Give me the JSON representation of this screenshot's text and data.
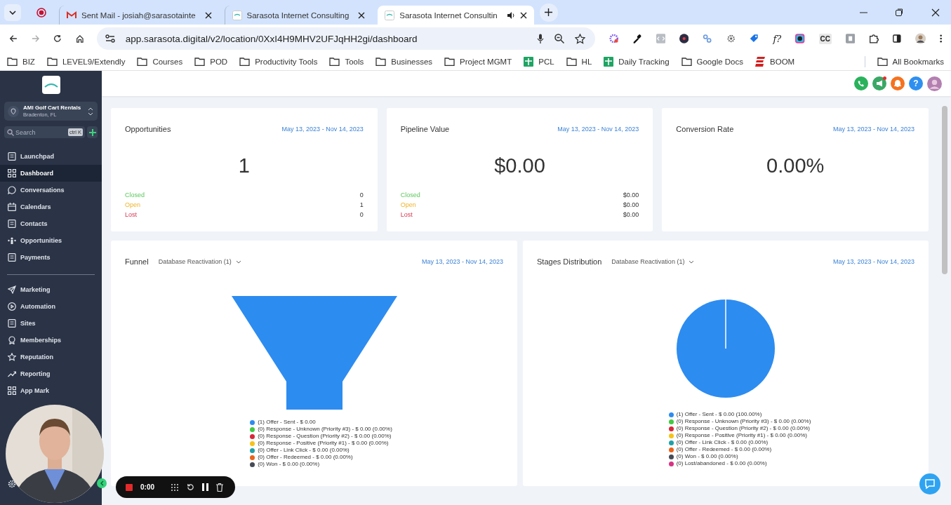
{
  "browser": {
    "tabs": [
      {
        "title": "Sent Mail - josiah@sarasotainte",
        "kind": "mail",
        "selected": false,
        "audio": false
      },
      {
        "title": "Sarasota Internet Consulting",
        "kind": "site",
        "selected": false,
        "audio": false
      },
      {
        "title": "Sarasota Internet Consultin",
        "kind": "site",
        "selected": true,
        "audio": true
      }
    ],
    "url": "app.sarasota.digital/v2/location/0XxI4H9MHV2UFJqHH2gi/dashboard",
    "extensions_text": [
      "f?",
      "CC"
    ],
    "bookmarks": [
      {
        "label": "BIZ",
        "kind": "folder"
      },
      {
        "label": "LEVEL9/Extendly",
        "kind": "folder"
      },
      {
        "label": "Courses",
        "kind": "folder"
      },
      {
        "label": "POD",
        "kind": "folder"
      },
      {
        "label": "Productivity Tools",
        "kind": "folder"
      },
      {
        "label": "Tools",
        "kind": "folder"
      },
      {
        "label": "Businesses",
        "kind": "folder"
      },
      {
        "label": "Project MGMT",
        "kind": "folder"
      },
      {
        "label": "PCL",
        "kind": "sheet"
      },
      {
        "label": "HL",
        "kind": "folder"
      },
      {
        "label": "Daily Tracking",
        "kind": "sheet"
      },
      {
        "label": "Google Docs",
        "kind": "folder"
      },
      {
        "label": "BOOM",
        "kind": "boom"
      }
    ],
    "all_bookmarks": "All Bookmarks"
  },
  "sidebar": {
    "account": {
      "name": "AMI Golf Cart Rentals",
      "location": "Bradenton, FL"
    },
    "search": {
      "placeholder": "Search",
      "shortcut": "ctrl K"
    },
    "groups": [
      [
        {
          "label": "Launchpad",
          "kind": "rocket",
          "selected": false
        },
        {
          "label": "Dashboard",
          "kind": "grid",
          "selected": true
        },
        {
          "label": "Conversations",
          "kind": "chat",
          "selected": false
        },
        {
          "label": "Calendars",
          "kind": "calendar",
          "selected": false
        },
        {
          "label": "Contacts",
          "kind": "contacts",
          "selected": false
        },
        {
          "label": "Opportunities",
          "kind": "funnel",
          "selected": false
        },
        {
          "label": "Payments",
          "kind": "payments",
          "selected": false
        }
      ],
      [
        {
          "label": "Marketing",
          "kind": "send",
          "selected": false
        },
        {
          "label": "Automation",
          "kind": "play",
          "selected": false
        },
        {
          "label": "Sites",
          "kind": "sites",
          "selected": false
        },
        {
          "label": "Memberships",
          "kind": "award",
          "selected": false
        },
        {
          "label": "Reputation",
          "kind": "star",
          "selected": false
        },
        {
          "label": "Reporting",
          "kind": "trend",
          "selected": false
        },
        {
          "label": "App Mark",
          "kind": "grid",
          "selected": false
        }
      ]
    ]
  },
  "header": {
    "help": "?"
  },
  "stat_cards": [
    {
      "title": "Opportunities",
      "dates": "May 13, 2023 - Nov 14, 2023",
      "value": "1",
      "rows": [
        {
          "label": "Closed",
          "value": "0"
        },
        {
          "label": "Open",
          "value": "1"
        },
        {
          "label": "Lost",
          "value": "0"
        }
      ]
    },
    {
      "title": "Pipeline Value",
      "dates": "May 13, 2023 - Nov 14, 2023",
      "value": "$0.00",
      "rows": [
        {
          "label": "Closed",
          "value": "$0.00"
        },
        {
          "label": "Open",
          "value": "$0.00"
        },
        {
          "label": "Lost",
          "value": "$0.00"
        }
      ]
    },
    {
      "title": "Conversion Rate",
      "dates": "May 13, 2023 - Nov 14, 2023",
      "value": "0.00%"
    }
  ],
  "chart_cards": [
    {
      "kind": "funnel",
      "title": "Funnel",
      "pipeline": "Database Reactivation (1)",
      "dates": "May 13, 2023 - Nov 14, 2023",
      "legend": [
        {
          "label": "(1) Offer - Sent - $ 0.00",
          "color": "#2d8cf0"
        },
        {
          "label": "(0) Response - Unknown (Priority #3) - $ 0.00 (0.00%)",
          "color": "#43c943"
        },
        {
          "label": "(0) Response - Question (Priority #2) - $ 0.00 (0.00%)",
          "color": "#d9263a"
        },
        {
          "label": "(0) Response - Positive (Priority #1) - $ 0.00 (0.00%)",
          "color": "#f5c21b"
        },
        {
          "label": "(0) Offer - Link Click - $ 0.00 (0.00%)",
          "color": "#1fa0a8"
        },
        {
          "label": "(0) Offer - Redeemed - $ 0.00 (0.00%)",
          "color": "#e8641c"
        },
        {
          "label": "(0) Won - $ 0.00 (0.00%)",
          "color": "#454a54"
        }
      ]
    },
    {
      "kind": "pie",
      "title": "Stages Distribution",
      "pipeline": "Database Reactivation (1)",
      "dates": "May 13, 2023 - Nov 14, 2023",
      "legend": [
        {
          "label": "(1) Offer - Sent - $ 0.00 (100.00%)",
          "color": "#2d8cf0"
        },
        {
          "label": "(0) Response - Unknown (Priority #3) - $ 0.00 (0.00%)",
          "color": "#43c943"
        },
        {
          "label": "(0) Response - Question (Priority #2) - $ 0.00 (0.00%)",
          "color": "#d9263a"
        },
        {
          "label": "(0) Response - Positive (Priority #1) - $ 0.00 (0.00%)",
          "color": "#f5c21b"
        },
        {
          "label": "(0) Offer - Link Click - $ 0.00 (0.00%)",
          "color": "#1fa0a8"
        },
        {
          "label": "(0) Offer - Redeemed - $ 0.00 (0.00%)",
          "color": "#e8641c"
        },
        {
          "label": "(0) Won - $ 0.00 (0.00%)",
          "color": "#454a54"
        },
        {
          "label": "(0) Lost/abandoned - $ 0.00 (0.00%)",
          "color": "#d63384"
        }
      ]
    }
  ],
  "recorder": {
    "time": "0:00"
  }
}
